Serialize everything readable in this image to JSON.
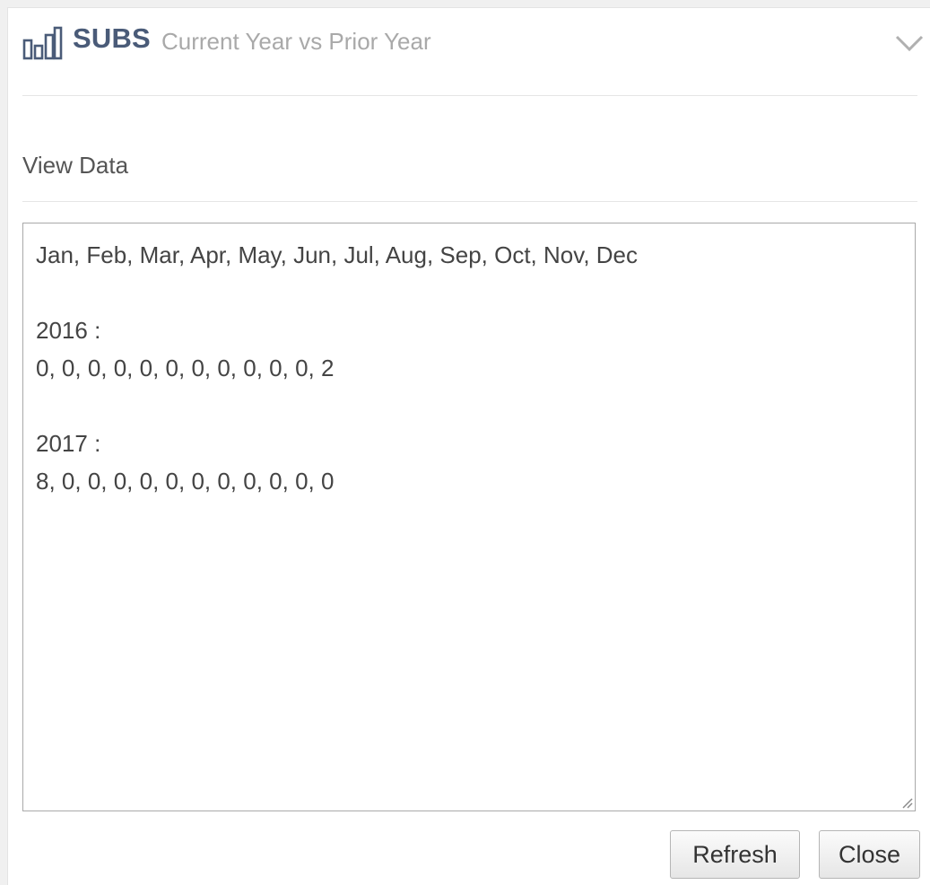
{
  "header": {
    "title": "SUBS",
    "subtitle": "Current Year vs Prior Year",
    "icons": {
      "chart": "bar-chart-icon",
      "collapse": "chevron-down-icon"
    }
  },
  "section": {
    "label": "View Data"
  },
  "data_view": {
    "months_line": "Jan, Feb, Mar, Apr, May, Jun, Jul, Aug, Sep, Oct, Nov, Dec",
    "series": [
      {
        "year_label": "2016 :",
        "values_line": "0, 0, 0, 0, 0, 0, 0, 0, 0, 0, 0, 2"
      },
      {
        "year_label": "2017 :",
        "values_line": "8, 0, 0, 0, 0, 0, 0, 0, 0, 0, 0, 0"
      }
    ]
  },
  "buttons": {
    "refresh_label": "Refresh",
    "close_label": "Close"
  },
  "colors": {
    "title": "#4a5b78",
    "subtitle": "#a9a9a9",
    "text": "#444444",
    "divider": "#e5e5e5"
  }
}
